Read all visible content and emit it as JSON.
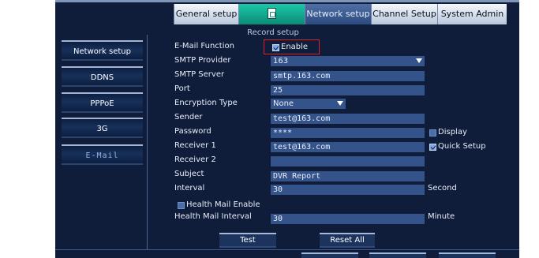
{
  "tabs": [
    {
      "label": "General setup"
    },
    {
      "label": ""
    },
    {
      "label": "Network setup"
    },
    {
      "label": "Channel Setup"
    },
    {
      "label": "System Admin"
    }
  ],
  "record_label": "Record setup",
  "sidebar": {
    "items": [
      {
        "label": "Network setup"
      },
      {
        "label": "DDNS"
      },
      {
        "label": "PPPoE"
      },
      {
        "label": "3G"
      },
      {
        "label": "E-Mail"
      }
    ]
  },
  "form": {
    "email_function_label": "E-Mail Function",
    "enable_label": "Enable",
    "enable_checked": true,
    "smtp_provider_label": "SMTP Provider",
    "smtp_provider_value": "163",
    "smtp_server_label": "SMTP Server",
    "smtp_server_value": "smtp.163.com",
    "port_label": "Port",
    "port_value": "25",
    "encryption_label": "Encryption Type",
    "encryption_value": "None",
    "sender_label": "Sender",
    "sender_value": "test@163.com",
    "password_label": "Password",
    "password_value": "****",
    "display_label": "Display",
    "display_checked": false,
    "receiver1_label": "Receiver 1",
    "receiver1_value": "test@163.com",
    "quick_setup_label": "Quick Setup",
    "quick_setup_checked": true,
    "receiver2_label": "Receiver 2",
    "receiver2_value": "",
    "subject_label": "Subject",
    "subject_value": "DVR Report",
    "interval_label": "Interval",
    "interval_value": "30",
    "interval_unit": "Second",
    "health_mail_enable_label": "Health Mail Enable",
    "health_mail_enable_checked": false,
    "health_mail_interval_label": "Health Mail Interval",
    "health_mail_interval_value": "30",
    "health_mail_interval_unit": "Minute"
  },
  "buttons": {
    "test": "Test",
    "reset_all": "Reset All"
  },
  "colors": {
    "background": "#0f1d3a",
    "field": "#33538a",
    "highlight_box": "#e02020",
    "record_tab": "#14a88f"
  }
}
